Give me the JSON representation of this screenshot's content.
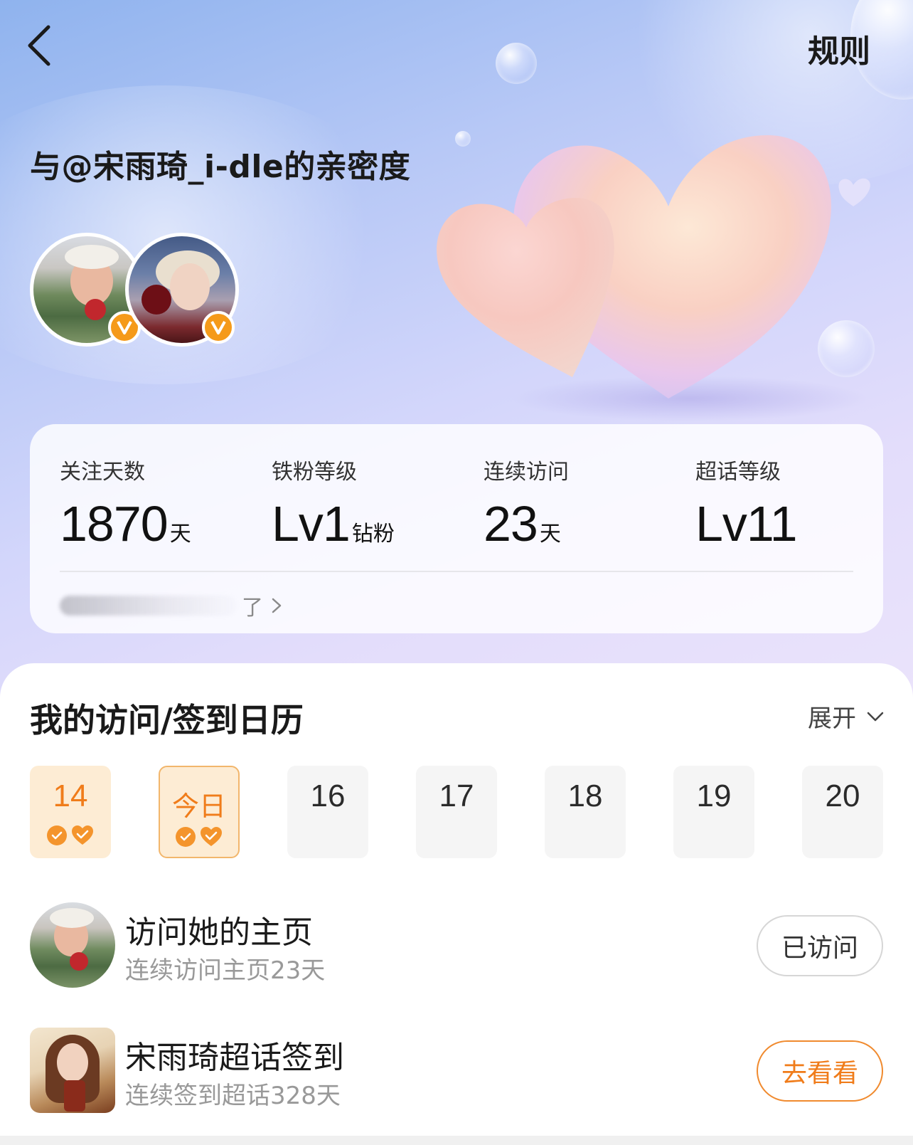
{
  "header": {
    "back_icon": "chevron-left-icon",
    "rules_label": "规则"
  },
  "hero": {
    "title": "与@宋雨琦_i-dle的亲密度",
    "avatars": [
      {
        "name": "my-avatar",
        "badge": "v-badge-icon"
      },
      {
        "name": "star-avatar",
        "badge": "v-badge-icon"
      }
    ],
    "illustration": "hearts-illustration",
    "colors": {
      "top": "#8fb3ee",
      "bottom": "#eae3fb"
    }
  },
  "stats": {
    "items": [
      {
        "label": "关注天数",
        "value": "1870",
        "unit": "天"
      },
      {
        "label": "铁粉等级",
        "value": "Lv1",
        "unit": "钻粉"
      },
      {
        "label": "连续访问",
        "value": "23",
        "unit": "天"
      },
      {
        "label": "超话等级",
        "value": "Lv11",
        "unit": ""
      }
    ],
    "footer_text": "了",
    "footer_arrow": "chevron-right-icon"
  },
  "calendar": {
    "title": "我的访问/签到日历",
    "expand_label": "展开",
    "days": [
      {
        "label": "14",
        "state": "done"
      },
      {
        "label": "今日",
        "state": "today"
      },
      {
        "label": "16",
        "state": "future"
      },
      {
        "label": "17",
        "state": "future"
      },
      {
        "label": "18",
        "state": "future"
      },
      {
        "label": "19",
        "state": "future"
      },
      {
        "label": "20",
        "state": "future"
      }
    ],
    "accent": "#f07c1a"
  },
  "tasks": [
    {
      "title": "访问她的主页",
      "subtitle": "连续访问主页23天",
      "button": "已访问",
      "button_state": "done"
    },
    {
      "title": "宋雨琦超话签到",
      "subtitle": "连续签到超话328天",
      "button": "去看看",
      "button_state": "go"
    }
  ]
}
